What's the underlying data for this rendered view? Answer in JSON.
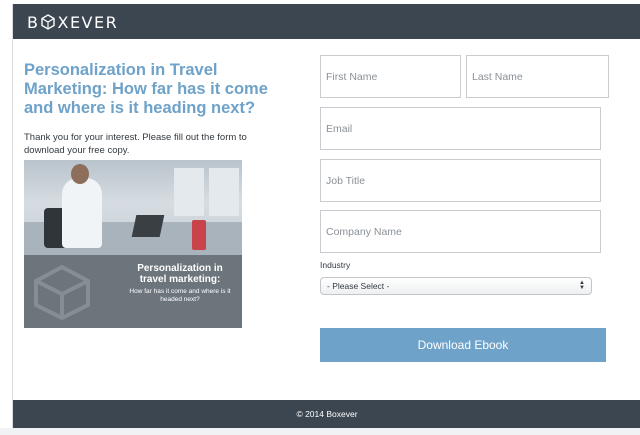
{
  "header": {
    "logo_left": "B",
    "logo_right": "XEVER",
    "logo_icon": "boxever-hexagon-icon",
    "background": "#3b4651"
  },
  "main": {
    "headline": "Personalization in Travel Marketing: How far has it come and where is it heading next?",
    "intro": "Thank you for your interest. Please fill out the form to download your free copy.",
    "cover": {
      "title": "Personalization in travel marketing:",
      "subtitle": "How far has it come and where is it headed next?"
    }
  },
  "form": {
    "first_name_placeholder": "First Name",
    "last_name_placeholder": "Last Name",
    "email_placeholder": "Email",
    "job_title_placeholder": "Job Title",
    "company_name_placeholder": "Company Name",
    "industry_label": "Industry",
    "industry_selected": "- Please Select -",
    "submit_label": "Download Ebook"
  },
  "footer": {
    "copyright": "© 2014 Boxever"
  },
  "colors": {
    "accent": "#6ea2c9",
    "dark_bar": "#3b4651"
  }
}
